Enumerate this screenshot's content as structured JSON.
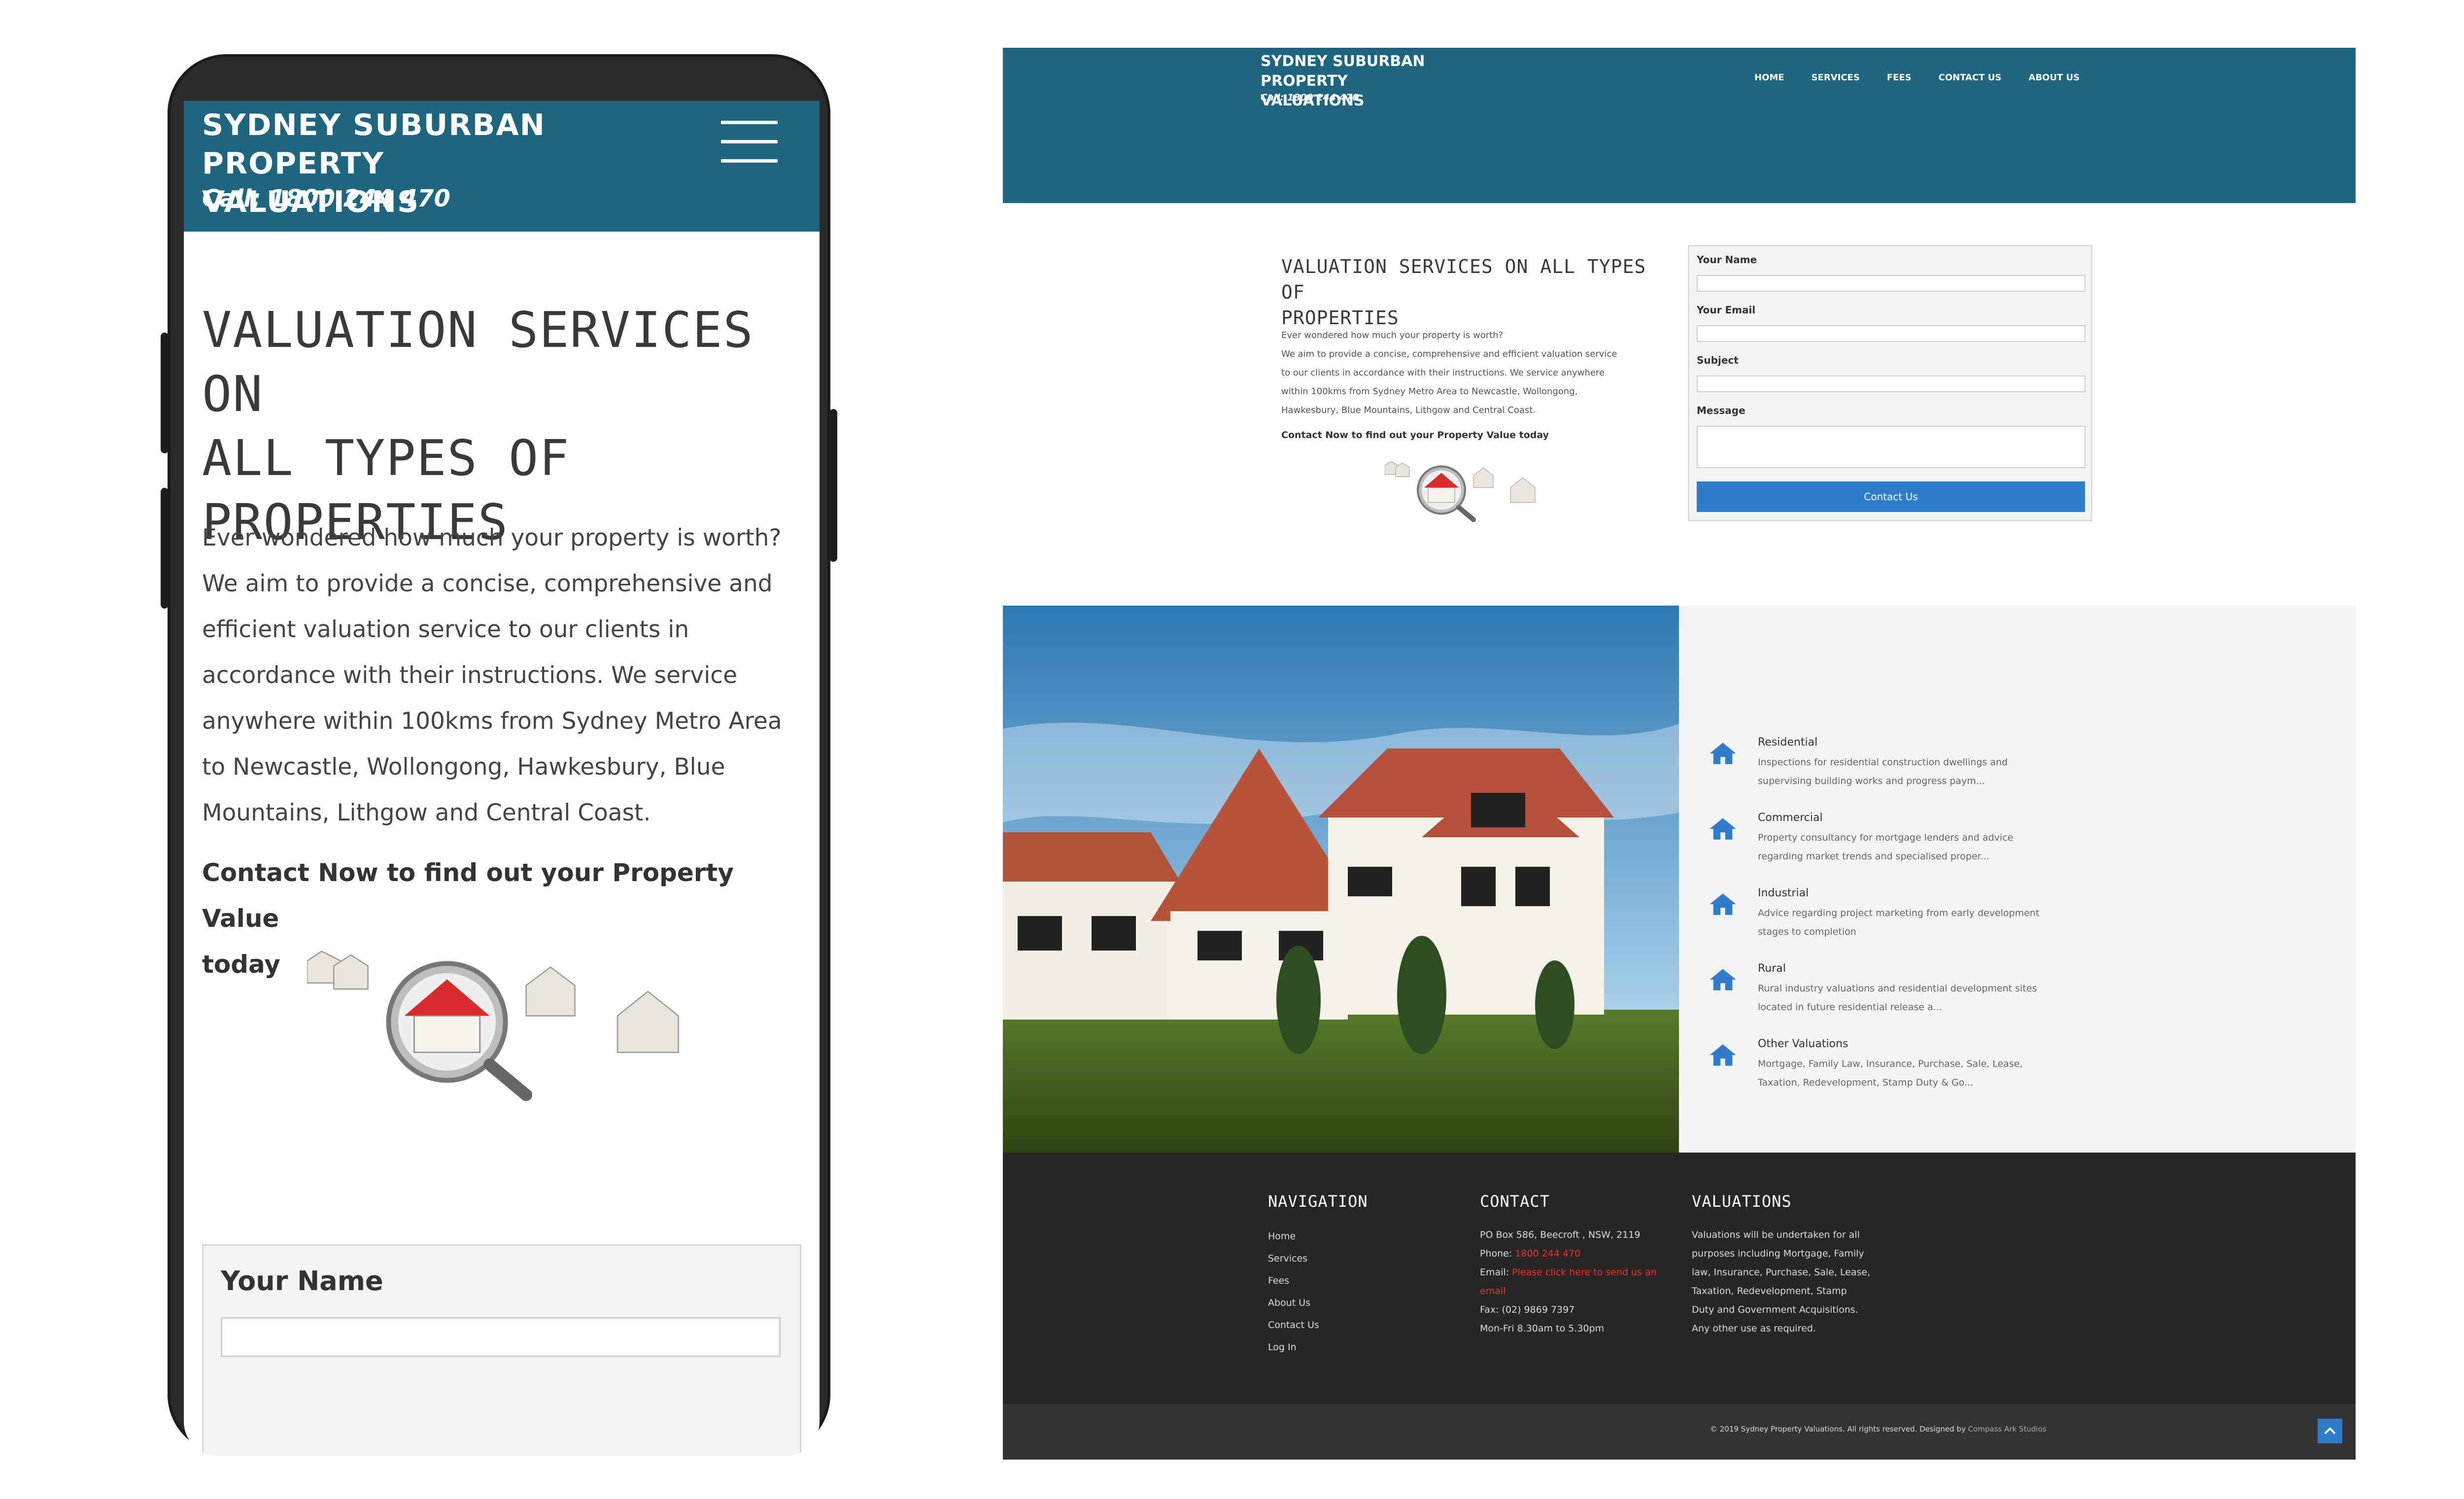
{
  "mobile": {
    "brand_line1": "SYDNEY SUBURBAN PROPERTY",
    "brand_line2": "VALUATIONS",
    "call": "Call: 1800 244 470",
    "heading_line1": "VALUATION SERVICES ON",
    "heading_line2": "ALL TYPES OF",
    "heading_line3": "PROPERTIES",
    "intro_line1": "Ever wondered how much your property is worth?",
    "intro_line2": "We aim to provide a concise, comprehensive and",
    "intro_line3": "efficient valuation service to our clients in",
    "intro_line4": "accordance with their instructions. We service",
    "intro_line5": "anywhere within 100kms from Sydney Metro Area",
    "intro_line6": "to Newcastle, Wollongong, Hawkesbury, Blue",
    "intro_line7": "Mountains, Lithgow and Central Coast.",
    "cta_line1": "Contact Now to find out your Property Value",
    "cta_line2": "today",
    "form_name_label": "Your Name"
  },
  "desktop": {
    "brand_line1": "SYDNEY SUBURBAN PROPERTY",
    "brand_line2": "VALUATIONS",
    "call": "Call: 1800 244 470",
    "nav": [
      "HOME",
      "SERVICES",
      "FEES",
      "CONTACT US",
      "ABOUT US"
    ],
    "heading_line1": "VALUATION SERVICES ON ALL TYPES OF",
    "heading_line2": "PROPERTIES",
    "intro_line1": "Ever wondered how much your property is worth?",
    "intro_line2": "We aim to provide a concise, comprehensive and efficient valuation service",
    "intro_line3": "to our clients in accordance with their instructions. We service anywhere",
    "intro_line4": "within 100kms from Sydney Metro Area to Newcastle, Wollongong,",
    "intro_line5": "Hawkesbury, Blue Mountains, Lithgow and Central Coast.",
    "cta": "Contact Now to find out your Property Value today",
    "form": {
      "name_label": "Your Name",
      "email_label": "Your Email",
      "subject_label": "Subject",
      "message_label": "Message",
      "submit_label": "Contact Us"
    },
    "services": [
      {
        "title": "Residential",
        "line1": "Inspections for residential construction dwellings and",
        "line2": "supervising building works and progress paym..."
      },
      {
        "title": "Commercial",
        "line1": "Property consultancy for mortgage lenders and advice",
        "line2": "regarding market trends and specialised proper..."
      },
      {
        "title": "Industrial",
        "line1": "Advice regarding project marketing from early development",
        "line2": "stages to completion"
      },
      {
        "title": "Rural",
        "line1": "Rural industry valuations and residential development sites",
        "line2": "located in future residential release a..."
      },
      {
        "title": "Other Valuations",
        "line1": "Mortgage, Family Law, Insurance, Purchase, Sale, Lease,",
        "line2": "Taxation, Redevelopment, Stamp Duty & Go..."
      }
    ],
    "footer": {
      "nav_heading": "NAVIGATION",
      "nav_links": [
        "Home",
        "Services",
        "Fees",
        "About Us",
        "Contact Us",
        "Log In"
      ],
      "contact_heading": "CONTACT",
      "address": "PO Box 586, Beecroft , NSW, 2119",
      "phone_label": "Phone: ",
      "phone": "1800 244 470",
      "email_label": "Email: ",
      "email_link_line1": "Please click here to send us an",
      "email_link_line2": "email",
      "fax": "Fax: (02) 9869 7397",
      "hours": "Mon-Fri 8.30am to 5.30pm",
      "valuations_heading": "VALUATIONS",
      "val_line1": "Valuations will be undertaken for all",
      "val_line2": "purposes including Mortgage, Family",
      "val_line3": "law, Insurance, Purchase, Sale, Lease,",
      "val_line4": "Taxation, Redevelopment, Stamp",
      "val_line5": "Duty and Government Acquisitions.",
      "val_line6": "Any other use as required.",
      "copyright": "© 2019 Sydney Property Valuations. All rights reserved. Designed by ",
      "designer": "Compass Ark Studios"
    }
  },
  "colors": {
    "header_teal": "#1e6680",
    "button_blue": "#2f7ecb",
    "footer_dark": "#262626",
    "link_red": "#e4362a"
  },
  "icons": [
    "hamburger-menu-icon",
    "house-icon",
    "scroll-top-arrow-icon"
  ]
}
